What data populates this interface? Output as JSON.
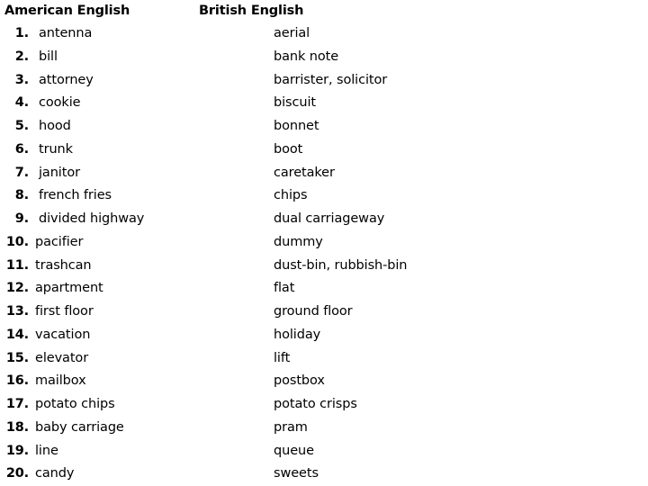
{
  "document": {
    "headers": {
      "american": "American English",
      "british": "British English"
    },
    "entries": [
      {
        "number": "1.",
        "american": "antenna",
        "british": "aerial"
      },
      {
        "number": "2.",
        "american": "bill",
        "british": "bank note"
      },
      {
        "number": "3.",
        "american": "attorney",
        "british": "barrister, solicitor"
      },
      {
        "number": "4.",
        "american": "cookie",
        "british": "biscuit"
      },
      {
        "number": "5.",
        "american": "hood",
        "british": "bonnet"
      },
      {
        "number": "6.",
        "american": "trunk",
        "british": "boot"
      },
      {
        "number": "7.",
        "american": "janitor",
        "british": "caretaker"
      },
      {
        "number": "8.",
        "american": "french fries",
        "british": "chips"
      },
      {
        "number": "9.",
        "american": "divided highway",
        "british": "dual carriageway"
      },
      {
        "number": "10.",
        "american": "pacifier",
        "british": "dummy"
      },
      {
        "number": "11.",
        "american": "trashcan",
        "british": "dust-bin, rubbish-bin"
      },
      {
        "number": "12.",
        "american": "apartment",
        "british": "flat"
      },
      {
        "number": "13.",
        "american": "first floor",
        "british": "ground floor"
      },
      {
        "number": "14.",
        "american": "vacation",
        "british": "holiday"
      },
      {
        "number": "15.",
        "american": "elevator",
        "british": "lift"
      },
      {
        "number": "16.",
        "american": "mailbox",
        "british": "postbox"
      },
      {
        "number": "17.",
        "american": "potato chips",
        "british": "potato crisps"
      },
      {
        "number": "18.",
        "american": "baby carriage",
        "british": "pram"
      },
      {
        "number": "19.",
        "american": "line",
        "british": "queue"
      },
      {
        "number": "20.",
        "american": "candy",
        "british": "sweets"
      }
    ]
  }
}
